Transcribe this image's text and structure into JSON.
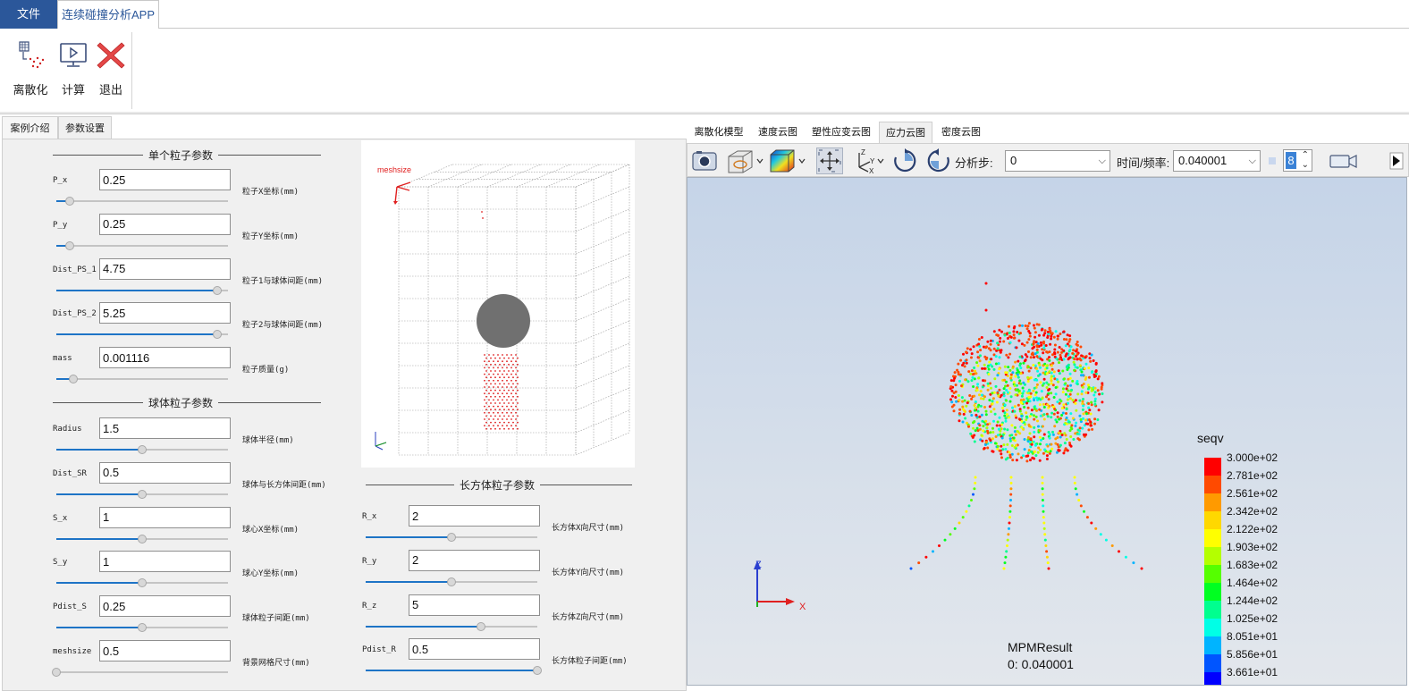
{
  "menubar": {
    "file_tab": "文件",
    "app_tab": "连续碰撞分析APP"
  },
  "ribbon": {
    "discretize": "离散化",
    "compute": "计算",
    "exit": "退出"
  },
  "left_tabs": [
    "案例介绍",
    "参数设置"
  ],
  "sections": {
    "single_particle": "单个粒子参数",
    "sphere_particle": "球体粒子参数",
    "cuboid_particle": "长方体粒子参数"
  },
  "params_left": [
    {
      "name": "P_x",
      "value": "0.25",
      "desc": "粒子X坐标(mm)",
      "level": 0.08
    },
    {
      "name": "P_y",
      "value": "0.25",
      "desc": "粒子Y坐标(mm)",
      "level": 0.08
    },
    {
      "name": "Dist_PS_1",
      "value": "4.75",
      "desc": "粒子1与球体间距(mm)",
      "level": 0.94
    },
    {
      "name": "Dist_PS_2",
      "value": "5.25",
      "desc": "粒子2与球体间距(mm)",
      "level": 0.94
    },
    {
      "name": "mass",
      "value": "0.001116",
      "desc": "粒子质量(g)",
      "level": 0.1
    }
  ],
  "params_sphere": [
    {
      "name": "Radius",
      "value": "1.5",
      "desc": "球体半径(mm)",
      "level": 0.5
    },
    {
      "name": "Dist_SR",
      "value": "0.5",
      "desc": "球体与长方体间距(mm)",
      "level": 0.5
    },
    {
      "name": "S_x",
      "value": "1",
      "desc": "球心X坐标(mm)",
      "level": 0.5
    },
    {
      "name": "S_y",
      "value": "1",
      "desc": "球心Y坐标(mm)",
      "level": 0.5
    },
    {
      "name": "Pdist_S",
      "value": "0.25",
      "desc": "球体粒子间距(mm)",
      "level": 0.5
    },
    {
      "name": "meshsize",
      "value": "0.5",
      "desc": "背景网格尺寸(mm)",
      "level": 0.0
    }
  ],
  "params_cuboid": [
    {
      "name": "R_x",
      "value": "2",
      "desc": "长方体X向尺寸(mm)",
      "level": 0.5
    },
    {
      "name": "R_y",
      "value": "2",
      "desc": "长方体Y向尺寸(mm)",
      "level": 0.5
    },
    {
      "name": "R_z",
      "value": "5",
      "desc": "长方体Z向尺寸(mm)",
      "level": 0.67
    },
    {
      "name": "Pdist_R",
      "value": "0.5",
      "desc": "长方体粒子间距(mm)",
      "level": 1.0
    }
  ],
  "preview": {
    "label": "meshsize"
  },
  "viewer_tabs": [
    "离散化模型",
    "速度云图",
    "塑性应变云图",
    "应力云图",
    "密度云图"
  ],
  "toolbar": {
    "step_label": "分析步:",
    "step_value": "0",
    "time_label": "时间/频率:",
    "time_value": "0.040001",
    "frame_value": "8"
  },
  "viewport": {
    "result_name": "MPMResult",
    "result_time": "0: 0.040001",
    "axis_x": "X",
    "axis_z": "Z"
  },
  "legend": {
    "title": "seqv",
    "labels": [
      "3.000e+02",
      "2.781e+02",
      "2.561e+02",
      "2.342e+02",
      "2.122e+02",
      "1.903e+02",
      "1.683e+02",
      "1.464e+02",
      "1.244e+02",
      "1.025e+02",
      "8.051e+01",
      "5.856e+01",
      "3.661e+01"
    ],
    "colors": [
      "#ff0000",
      "#ff4a00",
      "#ff9a00",
      "#ffd800",
      "#ffff00",
      "#b4ff00",
      "#55ff00",
      "#00ff21",
      "#00ff8f",
      "#00ffe6",
      "#00b4ff",
      "#0055ff",
      "#0000ff"
    ]
  }
}
